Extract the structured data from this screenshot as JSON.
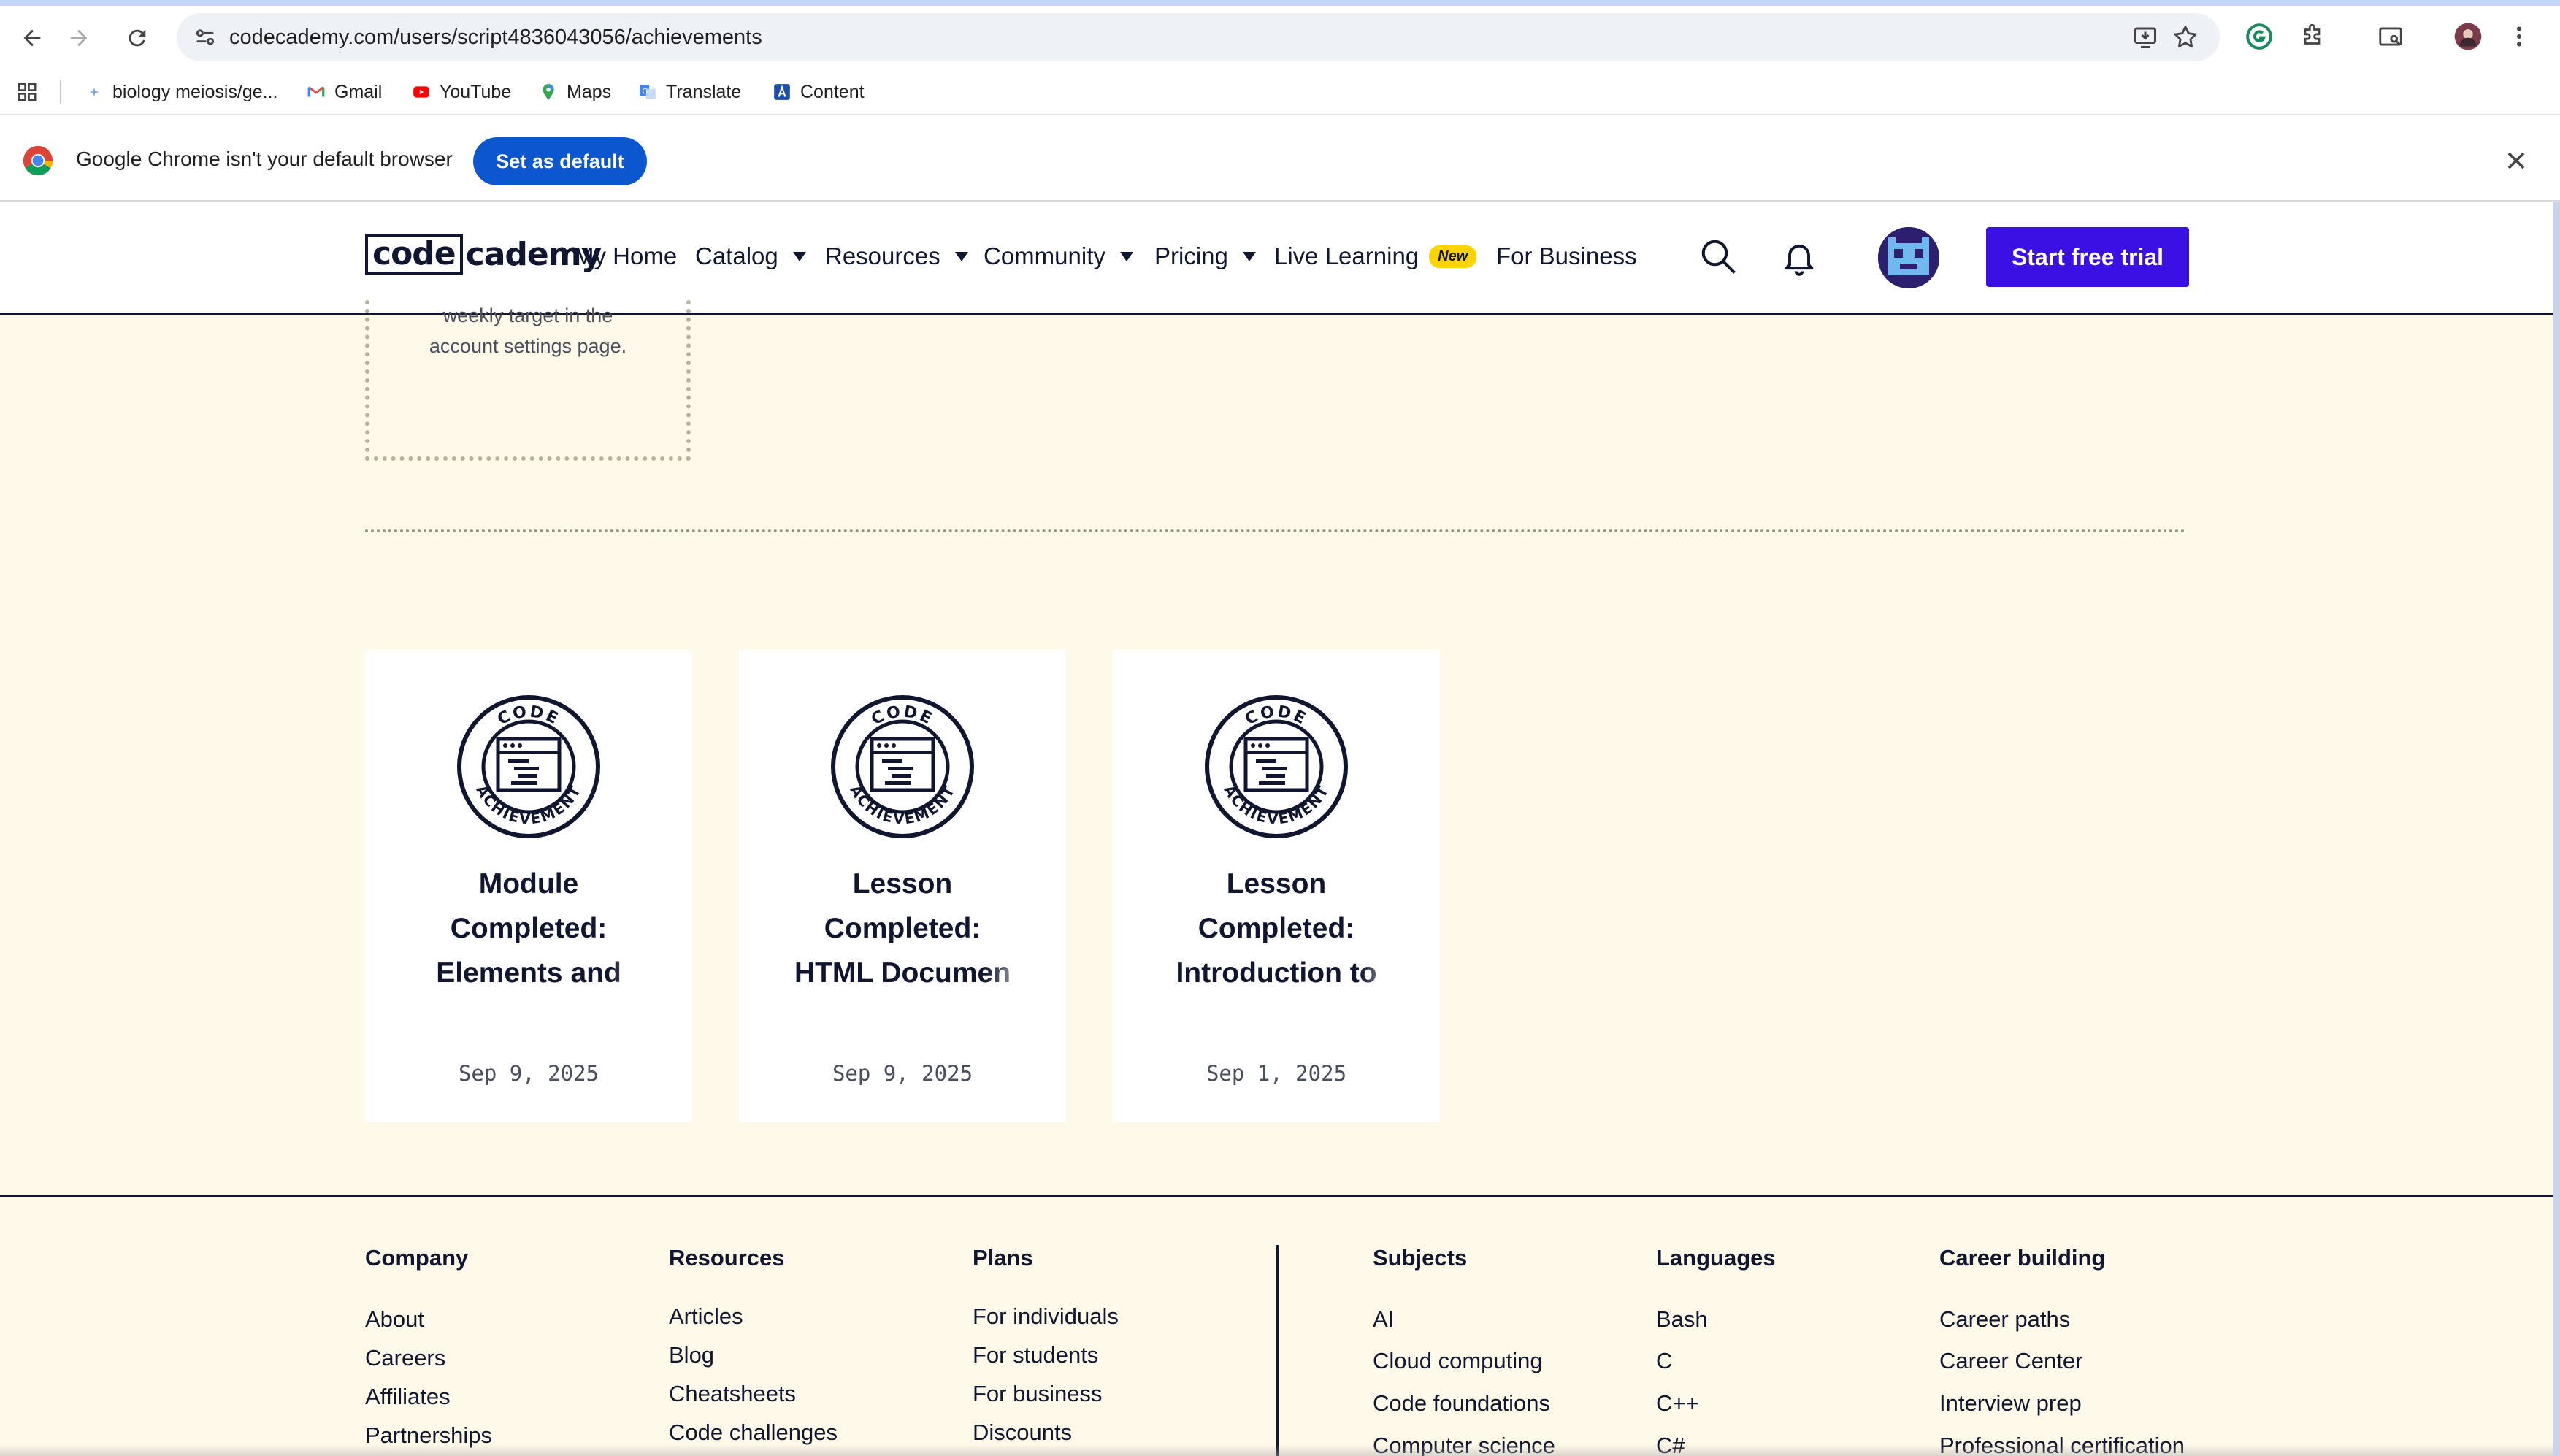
{
  "browser": {
    "url": "codecademy.com/users/script4836043056/achievements",
    "bookmarks": [
      {
        "label": "biology meiosis/ge...",
        "icon": "sparkle-icon"
      },
      {
        "label": "Gmail",
        "icon": "gmail-icon"
      },
      {
        "label": "YouTube",
        "icon": "youtube-icon"
      },
      {
        "label": "Maps",
        "icon": "maps-icon"
      },
      {
        "label": "Translate",
        "icon": "translate-icon"
      },
      {
        "label": "Content",
        "icon": "content-icon"
      }
    ],
    "infobar": {
      "message": "Google Chrome isn't your default browser",
      "button": "Set as default"
    }
  },
  "header": {
    "logo_code": "code",
    "logo_cademy": "cademy",
    "nav": [
      {
        "label": "My Home",
        "dropdown": false
      },
      {
        "label": "Catalog",
        "dropdown": true
      },
      {
        "label": "Resources",
        "dropdown": true
      },
      {
        "label": "Community",
        "dropdown": true
      },
      {
        "label": "Pricing",
        "dropdown": true
      },
      {
        "label": "Live Learning",
        "dropdown": false,
        "badge": "New"
      },
      {
        "label": "For Business",
        "dropdown": false
      }
    ],
    "cta": "Start free trial"
  },
  "main": {
    "target_text_line1": "weekly target in the",
    "target_text_line2": "account settings page.",
    "achievements": [
      {
        "title_lines": [
          "Module",
          "Completed:",
          "Elements and"
        ],
        "date": "Sep 9, 2025"
      },
      {
        "title_lines": [
          "Lesson",
          "Completed:",
          "HTML Documen"
        ],
        "date": "Sep 9, 2025"
      },
      {
        "title_lines": [
          "Lesson",
          "Completed:",
          "Introduction to"
        ],
        "date": "Sep 1, 2025"
      }
    ],
    "badge_top_text": "CODE",
    "badge_bottom_text": "ACHIEVEMENT"
  },
  "footer": {
    "columns": [
      {
        "heading": "Company",
        "links": [
          "About",
          "Careers",
          "Affiliates",
          "Partnerships"
        ]
      },
      {
        "heading": "Resources",
        "links": [
          "Articles",
          "Blog",
          "Cheatsheets",
          "Code challenges"
        ]
      },
      {
        "heading": "Plans",
        "links": [
          "For individuals",
          "For students",
          "For business",
          "Discounts"
        ]
      },
      {
        "heading": "Subjects",
        "links": [
          "AI",
          "Cloud computing",
          "Code foundations",
          "Computer science"
        ]
      },
      {
        "heading": "Languages",
        "links": [
          "Bash",
          "C",
          "C++",
          "C#"
        ]
      },
      {
        "heading": "Career building",
        "links": [
          "Career paths",
          "Career Center",
          "Interview prep",
          "Professional certification"
        ]
      }
    ]
  },
  "colors": {
    "brand_blue": "#3a10e5",
    "navy": "#10162f",
    "cream": "#fff9e9",
    "new_badge": "#ffd300",
    "chrome_blue": "#0b57d0"
  }
}
